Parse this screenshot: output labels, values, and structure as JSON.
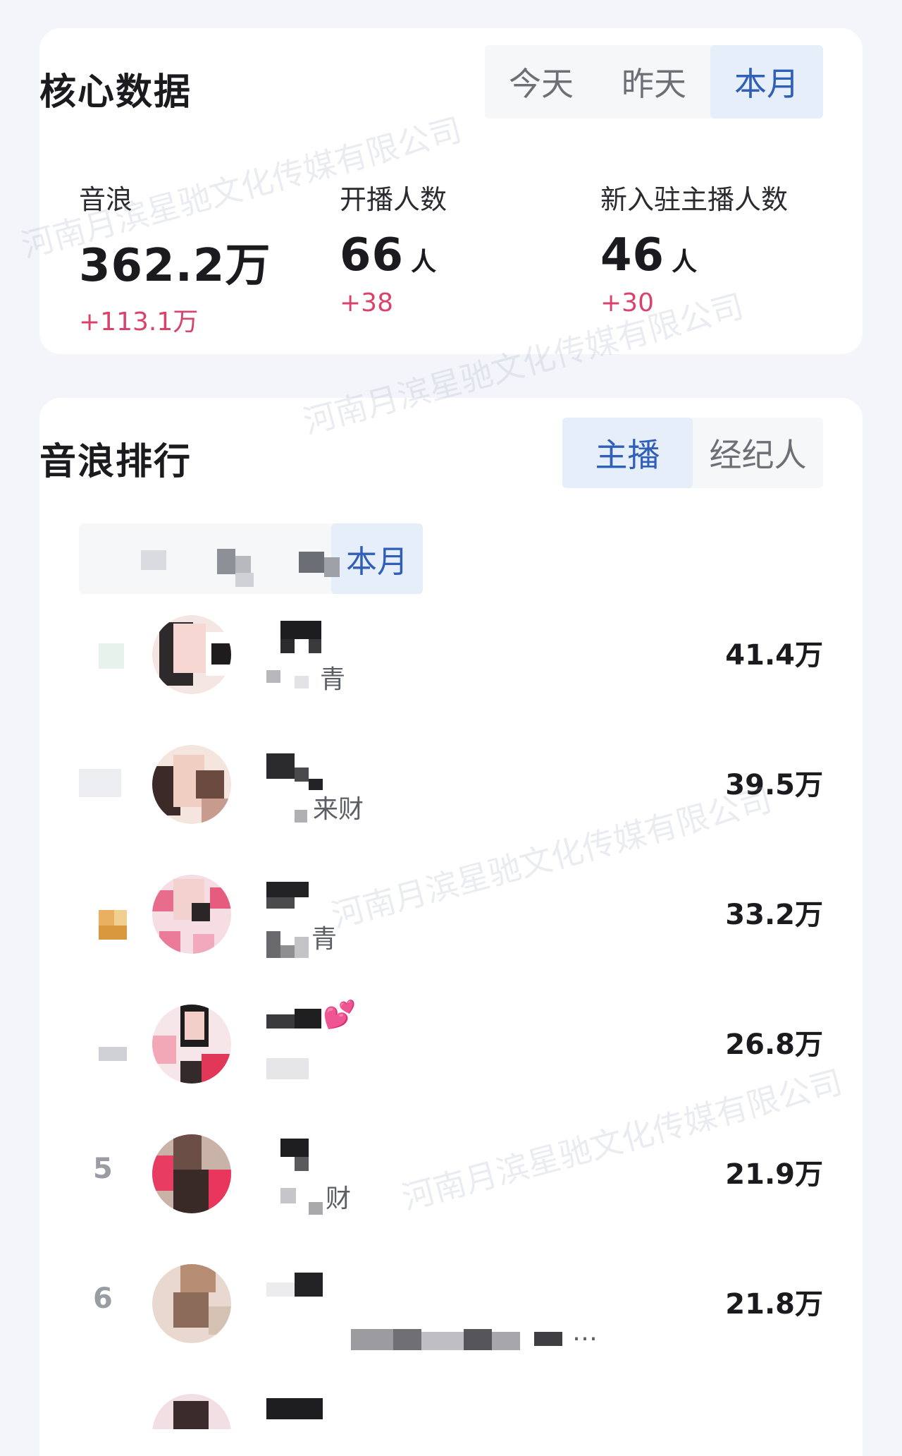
{
  "core": {
    "title": "核心数据",
    "tabs": [
      "今天",
      "昨天",
      "本月"
    ],
    "active_tab": "本月",
    "metrics": [
      {
        "label": "音浪",
        "value": "362.2万",
        "unit": "",
        "delta": "+113.1万"
      },
      {
        "label": "开播人数",
        "value": "66",
        "unit": "人",
        "delta": "+38"
      },
      {
        "label": "新入驻主播人数",
        "value": "46",
        "unit": "人",
        "delta": "+30"
      }
    ]
  },
  "ranking": {
    "title": "音浪排行",
    "tabs": [
      "主播",
      "经纪人"
    ],
    "active_tab": "主播",
    "period_active": "本月",
    "rows": [
      {
        "rank": "",
        "name_suffix": "",
        "sub_suffix": "青",
        "amount": "41.4万"
      },
      {
        "rank": "",
        "name_suffix": "",
        "sub_suffix": "来财",
        "amount": "39.5万"
      },
      {
        "rank": "",
        "name_suffix": "",
        "sub_suffix": "青",
        "amount": "33.2万"
      },
      {
        "rank": "",
        "name_suffix": "💕",
        "sub_suffix": "",
        "amount": "26.8万"
      },
      {
        "rank": "5",
        "name_suffix": "",
        "sub_suffix": "财",
        "amount": "21.9万"
      },
      {
        "rank": "6",
        "name_suffix": "",
        "sub_suffix": "…",
        "amount": "21.8万"
      }
    ]
  },
  "watermark_text": "河南月滨星驰文化传媒有限公司",
  "colors": {
    "background": "#f3f5fa",
    "card": "#ffffff",
    "accent_blue": "#2f5fb8",
    "active_tab_bg": "#e6eefa",
    "delta_pink": "#d9436b"
  }
}
